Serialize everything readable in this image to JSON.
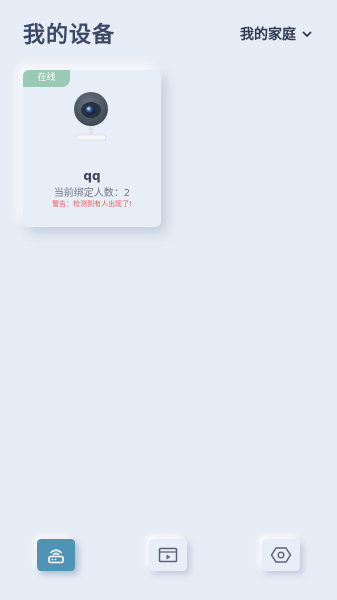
{
  "header": {
    "title": "我的设备",
    "family_selector": "我的家庭"
  },
  "devices": [
    {
      "status": "在线",
      "name": "qq",
      "bind_count": "当前绑定人数：2",
      "alert": "警告：检测到有人出现了!"
    }
  ],
  "bottom_nav": {
    "items": [
      {
        "icon": "router-icon",
        "active": true
      },
      {
        "icon": "video-player-icon",
        "active": false
      },
      {
        "icon": "hexagon-settings-icon",
        "active": false
      }
    ]
  },
  "colors": {
    "background": "#e7edf6",
    "online_badge": "#9ac9b6",
    "active_nav": "#4f93b7",
    "alert": "#e05f5f",
    "title": "#3d4a66"
  }
}
